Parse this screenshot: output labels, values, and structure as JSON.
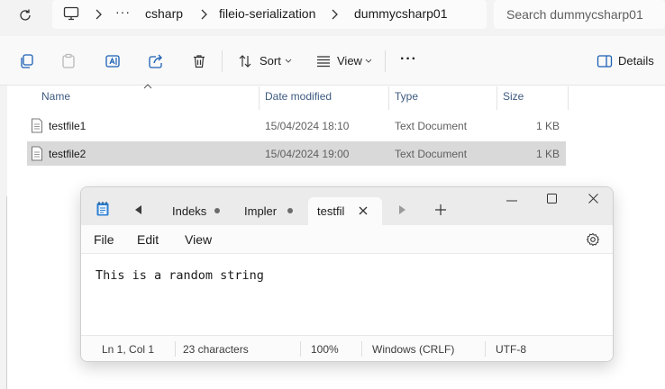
{
  "breadcrumb": {
    "items": [
      "csharp",
      "fileio-serialization",
      "dummycsharp01"
    ],
    "ellipsis": "···"
  },
  "search": {
    "placeholder": "Search dummycsharp01"
  },
  "commandbar": {
    "sort_label": "Sort",
    "view_label": "View",
    "more_label": "···",
    "details_label": "Details"
  },
  "columns": {
    "name": "Name",
    "date": "Date modified",
    "type": "Type",
    "size": "Size"
  },
  "files": [
    {
      "name": "testfile1",
      "date": "15/04/2024 18:10",
      "type": "Text Document",
      "size": "1 KB"
    },
    {
      "name": "testfile2",
      "date": "15/04/2024 19:00",
      "type": "Text Document",
      "size": "1 KB"
    }
  ],
  "notepad": {
    "tabs": [
      {
        "label": "Indeks"
      },
      {
        "label": "Impler"
      },
      {
        "label": "testfil"
      }
    ],
    "menu": {
      "file": "File",
      "edit": "Edit",
      "view": "View"
    },
    "content": "This is a random string",
    "status": {
      "position": "Ln 1, Col 1",
      "chars": "23 characters",
      "zoom": "100%",
      "line_ending": "Windows (CRLF)",
      "encoding": "UTF-8"
    }
  },
  "colors": {
    "selection": "#d9d9d9",
    "header_text": "#3d5a80",
    "accent_blue": "#1a5fb4"
  }
}
